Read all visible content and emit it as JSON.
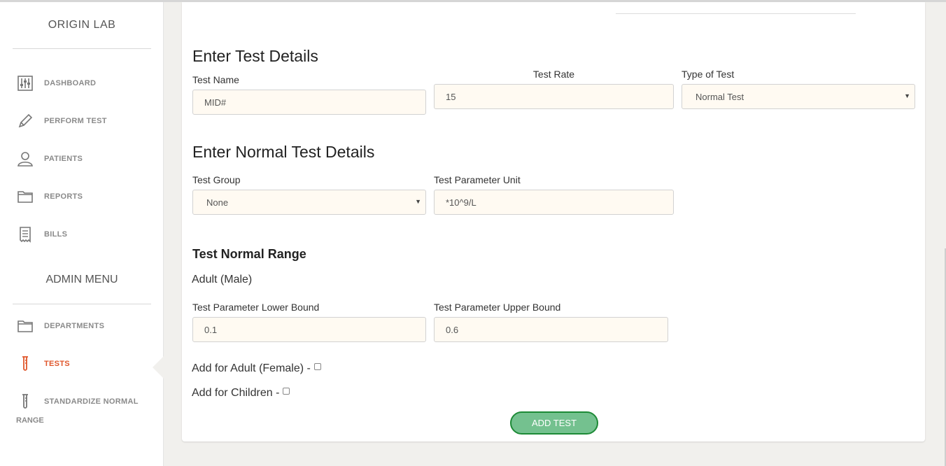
{
  "sidebar": {
    "brand": "ORIGIN LAB",
    "items": [
      {
        "label": "DASHBOARD",
        "icon": "sliders-icon"
      },
      {
        "label": "PERFORM TEST",
        "icon": "pencil-icon"
      },
      {
        "label": "PATIENTS",
        "icon": "user-icon"
      },
      {
        "label": "REPORTS",
        "icon": "folder-icon"
      },
      {
        "label": "BILLS",
        "icon": "receipt-icon"
      }
    ],
    "admin_title": "ADMIN MENU",
    "admin_items": [
      {
        "label": "DEPARTMENTS",
        "icon": "folder-icon"
      },
      {
        "label": "TESTS",
        "icon": "test-tube-icon",
        "active": true
      },
      {
        "label": "STANDARDIZE NORMAL",
        "label2": "RANGE",
        "icon": "test-tube-icon"
      }
    ],
    "active_color": "#e0572c"
  },
  "form": {
    "section1_title": "Enter Test Details",
    "test_name_label": "Test Name",
    "test_name_value": "MID#",
    "test_rate_label": "Test Rate",
    "test_rate_value": "15",
    "type_label": "Type of Test",
    "type_value": "Normal Test",
    "section2_title": "Enter Normal Test Details",
    "group_label": "Test Group",
    "group_value": "None",
    "unit_label": "Test Parameter Unit",
    "unit_value": "*10^9/L",
    "range_title": "Test Normal Range",
    "adult_male": "Adult (Male)",
    "lower_label": "Test Parameter Lower Bound",
    "lower_value": "0.1",
    "upper_label": "Test Parameter Upper Bound",
    "upper_value": "0.6",
    "add_female": "Add for Adult (Female) -",
    "add_children": "Add for Children -",
    "submit": "ADD TEST"
  },
  "colors": {
    "button_fill": "#74c18f",
    "button_border": "#1d8a36",
    "field_bg": "#fffaf2"
  }
}
